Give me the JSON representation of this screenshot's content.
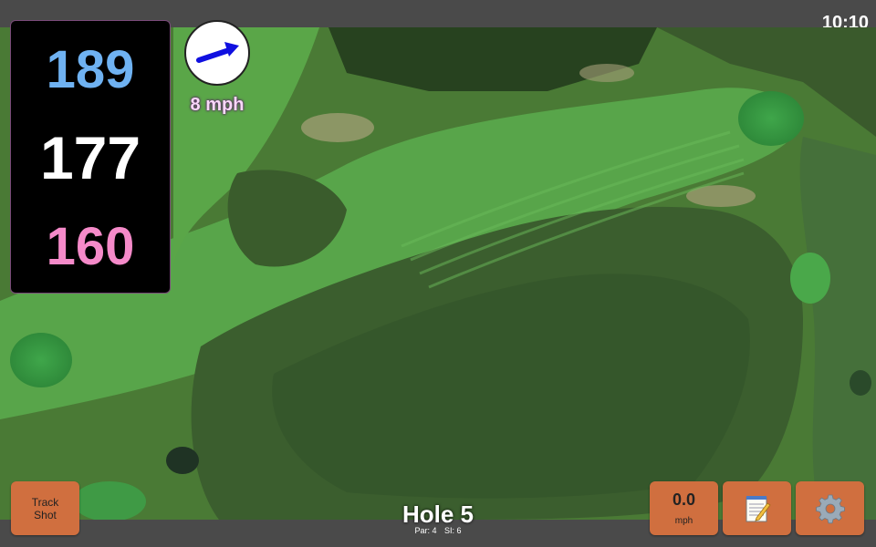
{
  "status": {
    "time": "10:10"
  },
  "distances": {
    "back": "189",
    "middle": "177",
    "front": "160"
  },
  "wind": {
    "speed": "8 mph",
    "direction_icon": "wind-arrow-icon"
  },
  "hole": {
    "title": "Hole 5",
    "par": "Par: 4",
    "stroke_index": "SI: 6"
  },
  "buttons": {
    "track_shot": {
      "line1": "Track",
      "line2": "Shot"
    },
    "speed": {
      "value": "0.0",
      "unit": "mph"
    },
    "notes_icon": "notepad-icon",
    "settings_icon": "gear-icon"
  },
  "colors": {
    "back_distance": "#6fb2f2",
    "middle_distance": "#ffffff",
    "front_distance": "#f58ac9",
    "button": "#d06f3f",
    "wind_arrow": "#1010e0"
  }
}
